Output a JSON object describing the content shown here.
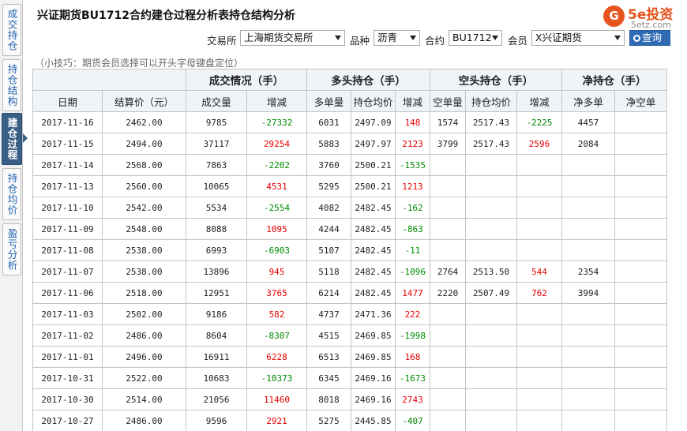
{
  "sidebar": {
    "tabs": [
      {
        "label": "成交持仓",
        "active": false
      },
      {
        "label": "持仓结构",
        "active": false
      },
      {
        "label": "建仓过程",
        "active": true
      },
      {
        "label": "持仓均价",
        "active": false
      },
      {
        "label": "盈亏分析",
        "active": false
      }
    ]
  },
  "header": {
    "title": "兴证期货BU1712合约建仓过程分析表持仓结构分析",
    "logo_badge": "G",
    "logo_text": "5e投资",
    "logo_sub": "5etz.com"
  },
  "filters": {
    "exchange_label": "交易所",
    "exchange_value": "上海期货交易所",
    "variety_label": "品种",
    "variety_value": "沥青",
    "contract_label": "合约",
    "contract_value": "BU1712",
    "member_label": "会员",
    "member_value": "X兴证期货",
    "query_label": "查询"
  },
  "tip": "（小技巧：期货会员选择可以开头字母键盘定位）",
  "table": {
    "groups": [
      "成交情况（手）",
      "多头持仓（手）",
      "空头持仓（手）",
      "净持仓（手）"
    ],
    "columns": [
      "日期",
      "结算价（元）",
      "成交量",
      "增减",
      "多单量",
      "持仓均价",
      "增减",
      "空单量",
      "持仓均价",
      "增减",
      "净多单",
      "净空单"
    ],
    "rows": [
      [
        "2017-11-16",
        "2462.00",
        "9785",
        "-27332",
        "6031",
        "2497.09",
        "148",
        "1574",
        "2517.43",
        "-2225",
        "4457",
        ""
      ],
      [
        "2017-11-15",
        "2494.00",
        "37117",
        "29254",
        "5883",
        "2497.97",
        "2123",
        "3799",
        "2517.43",
        "2596",
        "2084",
        ""
      ],
      [
        "2017-11-14",
        "2568.00",
        "7863",
        "-2202",
        "3760",
        "2500.21",
        "-1535",
        "",
        "",
        "",
        "",
        ""
      ],
      [
        "2017-11-13",
        "2560.00",
        "10065",
        "4531",
        "5295",
        "2500.21",
        "1213",
        "",
        "",
        "",
        "",
        ""
      ],
      [
        "2017-11-10",
        "2542.00",
        "5534",
        "-2554",
        "4082",
        "2482.45",
        "-162",
        "",
        "",
        "",
        "",
        ""
      ],
      [
        "2017-11-09",
        "2548.00",
        "8088",
        "1095",
        "4244",
        "2482.45",
        "-863",
        "",
        "",
        "",
        "",
        ""
      ],
      [
        "2017-11-08",
        "2538.00",
        "6993",
        "-6903",
        "5107",
        "2482.45",
        "-11",
        "",
        "",
        "",
        "",
        ""
      ],
      [
        "2017-11-07",
        "2538.00",
        "13896",
        "945",
        "5118",
        "2482.45",
        "-1096",
        "2764",
        "2513.50",
        "544",
        "2354",
        ""
      ],
      [
        "2017-11-06",
        "2518.00",
        "12951",
        "3765",
        "6214",
        "2482.45",
        "1477",
        "2220",
        "2507.49",
        "762",
        "3994",
        ""
      ],
      [
        "2017-11-03",
        "2502.00",
        "9186",
        "582",
        "4737",
        "2471.36",
        "222",
        "",
        "",
        "",
        "",
        ""
      ],
      [
        "2017-11-02",
        "2486.00",
        "8604",
        "-8307",
        "4515",
        "2469.85",
        "-1998",
        "",
        "",
        "",
        "",
        ""
      ],
      [
        "2017-11-01",
        "2496.00",
        "16911",
        "6228",
        "6513",
        "2469.85",
        "168",
        "",
        "",
        "",
        "",
        ""
      ],
      [
        "2017-10-31",
        "2522.00",
        "10683",
        "-10373",
        "6345",
        "2469.16",
        "-1673",
        "",
        "",
        "",
        "",
        ""
      ],
      [
        "2017-10-30",
        "2514.00",
        "21056",
        "11460",
        "8018",
        "2469.16",
        "2743",
        "",
        "",
        "",
        "",
        ""
      ],
      [
        "2017-10-27",
        "2486.00",
        "9596",
        "2921",
        "5275",
        "2445.85",
        "-407",
        "",
        "",
        "",
        "",
        ""
      ]
    ]
  },
  "colors": {
    "accent": "#2f6ab4",
    "active_tab": "#3a5f87",
    "increase": "#e60000",
    "decrease": "#008a00",
    "logo": "#e8541e"
  }
}
